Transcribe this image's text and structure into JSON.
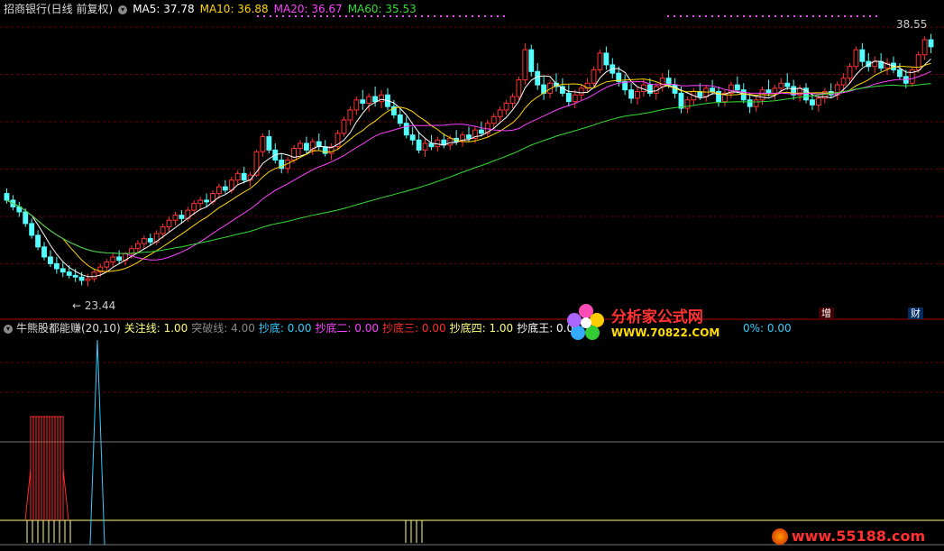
{
  "header": {
    "stock": "招商银行(日线 前复权)",
    "ma": [
      {
        "label": "MA5: 37.78",
        "color": "#ffffff"
      },
      {
        "label": "MA10: 36.88",
        "color": "#ffd700"
      },
      {
        "label": "MA20: 36.67",
        "color": "#ff40ff"
      },
      {
        "label": "MA60: 35.53",
        "color": "#33dd33"
      }
    ]
  },
  "price_labels": {
    "high": "38.55",
    "low": "23.44"
  },
  "indicator": {
    "name": "牛熊股都能赚(20,10)",
    "values": [
      {
        "label": "关注线: 1.00",
        "color": "#ffff80"
      },
      {
        "label": "突破线: 4.00",
        "color": "#888888"
      },
      {
        "label": "抄底: 0.00",
        "color": "#33ccff"
      },
      {
        "label": "抄底二: 0.00",
        "color": "#ff40ff"
      },
      {
        "label": "抄底三: 0.00",
        "color": "#ff3030"
      },
      {
        "label": "抄底四: 1.00",
        "color": "#ffff80"
      },
      {
        "label": "抄底王: 0.0",
        "color": "#ffffff"
      },
      {
        "label": "0%: 0.00",
        "color": "#33ccff"
      }
    ]
  },
  "tags": {
    "zeng": "增",
    "cai": "财"
  },
  "watermark": {
    "name": "分析家公式网",
    "url": "WWW.70822.COM",
    "url2": "www.55188.com"
  },
  "colors": {
    "up": "#ff3232",
    "down": "#54ffff",
    "ma5": "#ffffff",
    "ma10": "#ffd700",
    "ma20": "#ff40ff",
    "ma60": "#33dd33"
  },
  "chart_data": {
    "type": "candlestick",
    "price_range": [
      22.5,
      39.5
    ],
    "candles": [
      [
        29.0,
        29.3,
        28.4,
        28.6
      ],
      [
        28.6,
        28.9,
        28.0,
        28.2
      ],
      [
        28.2,
        28.5,
        27.6,
        27.9
      ],
      [
        27.9,
        28.1,
        27.0,
        27.2
      ],
      [
        27.2,
        27.5,
        26.3,
        26.5
      ],
      [
        26.5,
        26.8,
        25.6,
        25.8
      ],
      [
        25.8,
        26.1,
        25.0,
        25.2
      ],
      [
        25.2,
        25.6,
        24.6,
        24.8
      ],
      [
        24.8,
        25.2,
        24.2,
        24.5
      ],
      [
        24.5,
        24.9,
        24.0,
        24.3
      ],
      [
        24.3,
        24.7,
        23.9,
        24.1
      ],
      [
        24.1,
        24.5,
        23.7,
        24.0
      ],
      [
        24.0,
        24.3,
        23.5,
        23.8
      ],
      [
        23.8,
        24.2,
        23.44,
        23.9
      ],
      [
        23.9,
        24.5,
        23.7,
        24.3
      ],
      [
        24.3,
        24.8,
        24.0,
        24.6
      ],
      [
        24.6,
        25.1,
        24.3,
        24.9
      ],
      [
        24.9,
        25.4,
        24.6,
        25.2
      ],
      [
        25.2,
        25.6,
        24.8,
        25.0
      ],
      [
        25.0,
        25.5,
        24.7,
        25.4
      ],
      [
        25.4,
        25.9,
        25.1,
        25.7
      ],
      [
        25.7,
        26.2,
        25.4,
        26.0
      ],
      [
        26.0,
        26.5,
        25.7,
        26.3
      ],
      [
        26.3,
        26.6,
        25.9,
        26.1
      ],
      [
        26.1,
        26.8,
        25.9,
        26.6
      ],
      [
        26.6,
        27.2,
        26.3,
        27.0
      ],
      [
        27.0,
        27.6,
        26.7,
        27.4
      ],
      [
        27.4,
        27.9,
        27.1,
        27.7
      ],
      [
        27.7,
        28.0,
        27.2,
        27.5
      ],
      [
        27.5,
        28.2,
        27.3,
        28.0
      ],
      [
        28.0,
        28.6,
        27.7,
        28.4
      ],
      [
        28.4,
        28.8,
        28.0,
        28.6
      ],
      [
        28.6,
        29.0,
        28.2,
        28.5
      ],
      [
        28.5,
        29.2,
        28.3,
        29.0
      ],
      [
        29.0,
        29.6,
        28.7,
        29.4
      ],
      [
        29.4,
        29.8,
        29.0,
        29.2
      ],
      [
        29.2,
        30.0,
        29.0,
        29.8
      ],
      [
        29.8,
        30.4,
        29.5,
        30.2
      ],
      [
        30.2,
        30.6,
        29.6,
        29.8
      ],
      [
        29.8,
        30.3,
        29.4,
        30.1
      ],
      [
        30.1,
        31.6,
        30.0,
        31.5
      ],
      [
        31.5,
        32.6,
        31.2,
        32.4
      ],
      [
        32.4,
        32.8,
        31.4,
        31.6
      ],
      [
        31.6,
        32.0,
        30.8,
        31.0
      ],
      [
        31.0,
        31.4,
        30.2,
        30.5
      ],
      [
        30.5,
        31.2,
        30.2,
        31.0
      ],
      [
        31.0,
        31.9,
        30.8,
        31.7
      ],
      [
        31.7,
        32.2,
        31.3,
        32.0
      ],
      [
        32.0,
        32.4,
        31.4,
        31.6
      ],
      [
        31.6,
        32.3,
        31.3,
        32.1
      ],
      [
        32.1,
        32.6,
        31.6,
        31.8
      ],
      [
        31.8,
        32.2,
        31.2,
        31.4
      ],
      [
        31.4,
        32.0,
        31.0,
        31.8
      ],
      [
        31.8,
        32.8,
        31.6,
        32.6
      ],
      [
        32.6,
        33.6,
        32.4,
        33.4
      ],
      [
        33.4,
        34.2,
        33.1,
        34.0
      ],
      [
        34.0,
        34.8,
        33.7,
        34.6
      ],
      [
        34.6,
        35.2,
        34.0,
        34.4
      ],
      [
        34.4,
        35.0,
        33.9,
        34.8
      ],
      [
        34.8,
        35.4,
        34.2,
        34.5
      ],
      [
        34.5,
        35.2,
        34.1,
        34.9
      ],
      [
        34.9,
        35.3,
        34.0,
        34.2
      ],
      [
        34.2,
        34.6,
        33.5,
        33.7
      ],
      [
        33.7,
        34.1,
        33.0,
        33.2
      ],
      [
        33.2,
        33.6,
        32.3,
        32.5
      ],
      [
        32.5,
        33.0,
        31.9,
        32.2
      ],
      [
        32.2,
        32.7,
        31.4,
        31.6
      ],
      [
        31.6,
        32.3,
        31.2,
        32.0
      ],
      [
        32.0,
        32.5,
        31.6,
        31.8
      ],
      [
        31.8,
        32.4,
        31.5,
        32.2
      ],
      [
        32.2,
        32.6,
        31.7,
        31.9
      ],
      [
        31.9,
        32.5,
        31.6,
        32.3
      ],
      [
        32.3,
        32.8,
        31.9,
        32.1
      ],
      [
        32.1,
        32.7,
        31.8,
        32.5
      ],
      [
        32.5,
        33.0,
        32.1,
        32.3
      ],
      [
        32.3,
        33.0,
        32.0,
        32.8
      ],
      [
        32.8,
        33.3,
        32.4,
        32.6
      ],
      [
        32.6,
        33.4,
        32.4,
        33.2
      ],
      [
        33.2,
        33.8,
        32.9,
        33.6
      ],
      [
        33.6,
        34.2,
        33.3,
        34.0
      ],
      [
        34.0,
        34.6,
        33.7,
        34.4
      ],
      [
        34.4,
        35.0,
        34.1,
        34.8
      ],
      [
        34.8,
        36.0,
        34.6,
        35.8
      ],
      [
        35.8,
        38.0,
        35.5,
        37.6
      ],
      [
        37.6,
        37.9,
        36.0,
        36.3
      ],
      [
        36.3,
        36.8,
        35.2,
        35.5
      ],
      [
        35.5,
        36.0,
        34.6,
        35.0
      ],
      [
        35.0,
        35.8,
        34.7,
        35.6
      ],
      [
        35.6,
        36.2,
        35.1,
        35.4
      ],
      [
        35.4,
        35.9,
        34.8,
        35.0
      ],
      [
        35.0,
        35.5,
        34.2,
        34.5
      ],
      [
        34.5,
        35.2,
        34.1,
        34.9
      ],
      [
        34.9,
        35.5,
        34.6,
        35.3
      ],
      [
        35.3,
        35.9,
        35.0,
        35.6
      ],
      [
        35.6,
        36.6,
        35.4,
        36.4
      ],
      [
        36.4,
        37.6,
        36.2,
        37.4
      ],
      [
        37.4,
        37.8,
        36.4,
        36.7
      ],
      [
        36.7,
        37.1,
        35.9,
        36.2
      ],
      [
        36.2,
        36.6,
        35.4,
        35.7
      ],
      [
        35.7,
        36.1,
        34.9,
        35.2
      ],
      [
        35.2,
        35.6,
        34.4,
        34.7
      ],
      [
        34.7,
        35.4,
        34.3,
        35.1
      ],
      [
        35.1,
        35.8,
        34.8,
        35.5
      ],
      [
        35.5,
        35.9,
        34.8,
        35.0
      ],
      [
        35.0,
        35.6,
        34.6,
        35.4
      ],
      [
        35.4,
        36.2,
        35.1,
        35.9
      ],
      [
        35.9,
        36.4,
        35.3,
        35.5
      ],
      [
        35.5,
        35.9,
        34.7,
        35.0
      ],
      [
        35.0,
        35.4,
        33.8,
        34.1
      ],
      [
        34.1,
        34.8,
        33.8,
        34.6
      ],
      [
        34.6,
        35.3,
        34.3,
        35.1
      ],
      [
        35.1,
        35.6,
        34.6,
        34.8
      ],
      [
        34.8,
        35.5,
        34.5,
        35.3
      ],
      [
        35.3,
        35.8,
        34.9,
        35.1
      ],
      [
        35.1,
        35.4,
        34.2,
        34.5
      ],
      [
        34.5,
        35.2,
        34.2,
        35.0
      ],
      [
        35.0,
        35.7,
        34.7,
        35.5
      ],
      [
        35.5,
        36.0,
        35.0,
        35.2
      ],
      [
        35.2,
        35.6,
        34.4,
        34.6
      ],
      [
        34.6,
        35.0,
        33.8,
        34.2
      ],
      [
        34.2,
        34.8,
        33.9,
        34.6
      ],
      [
        34.6,
        35.4,
        34.3,
        35.2
      ],
      [
        35.2,
        35.8,
        34.8,
        35.0
      ],
      [
        35.0,
        35.5,
        34.6,
        35.3
      ],
      [
        35.3,
        35.9,
        35.0,
        35.6
      ],
      [
        35.6,
        36.2,
        35.2,
        35.4
      ],
      [
        35.4,
        35.8,
        34.6,
        34.9
      ],
      [
        34.9,
        35.5,
        34.5,
        35.3
      ],
      [
        35.3,
        35.6,
        34.4,
        34.6
      ],
      [
        34.6,
        35.0,
        34.0,
        34.3
      ],
      [
        34.3,
        34.9,
        33.9,
        34.7
      ],
      [
        34.7,
        35.3,
        34.4,
        35.1
      ],
      [
        35.1,
        35.6,
        34.7,
        34.9
      ],
      [
        34.9,
        35.7,
        34.6,
        35.5
      ],
      [
        35.5,
        36.2,
        35.1,
        35.9
      ],
      [
        35.9,
        36.8,
        35.6,
        36.6
      ],
      [
        36.6,
        37.8,
        36.4,
        37.6
      ],
      [
        37.6,
        38.0,
        36.6,
        36.9
      ],
      [
        36.9,
        37.4,
        36.3,
        36.6
      ],
      [
        36.6,
        37.2,
        36.2,
        36.9
      ],
      [
        36.9,
        37.4,
        36.3,
        36.5
      ],
      [
        36.5,
        37.1,
        36.1,
        36.8
      ],
      [
        36.8,
        37.2,
        36.2,
        36.4
      ],
      [
        36.4,
        36.8,
        35.8,
        36.0
      ],
      [
        36.0,
        36.4,
        35.3,
        35.6
      ],
      [
        35.6,
        36.6,
        35.4,
        36.4
      ],
      [
        36.4,
        37.5,
        36.2,
        37.3
      ],
      [
        37.3,
        38.4,
        37.0,
        38.2
      ],
      [
        38.2,
        38.55,
        37.4,
        37.78
      ]
    ],
    "ma_series": [
      "MA5",
      "MA10",
      "MA20",
      "MA60"
    ],
    "indicator_values": [
      0,
      0,
      0,
      0,
      0,
      0,
      0,
      0,
      0,
      0,
      0,
      0,
      0,
      0,
      0,
      0,
      0,
      0,
      0,
      0,
      0,
      0,
      0,
      0,
      0,
      0,
      0,
      0,
      0,
      0,
      0,
      0,
      0,
      0,
      0,
      0,
      0,
      0,
      0,
      0,
      0,
      0,
      0,
      0,
      0,
      0,
      0,
      0,
      0,
      0,
      0,
      0,
      0,
      0,
      0,
      0,
      0,
      0,
      0,
      0,
      0,
      0,
      0,
      0,
      0,
      0,
      0,
      0,
      0,
      0,
      0,
      0,
      0,
      0,
      0,
      0,
      0,
      0,
      0,
      0,
      0,
      0,
      0,
      0,
      0,
      0,
      0,
      0,
      0,
      0,
      0,
      0,
      0,
      0,
      0,
      0,
      0,
      0,
      0,
      0,
      0,
      0,
      0,
      0,
      0,
      0,
      0,
      0,
      0,
      0,
      0,
      0,
      0,
      0,
      0,
      0,
      0,
      0,
      0,
      0,
      0,
      0,
      0,
      0,
      0,
      0,
      0,
      0,
      0,
      0,
      0,
      0,
      0,
      0,
      0,
      0,
      0,
      0,
      0,
      0,
      0,
      0,
      0,
      0,
      0
    ]
  }
}
